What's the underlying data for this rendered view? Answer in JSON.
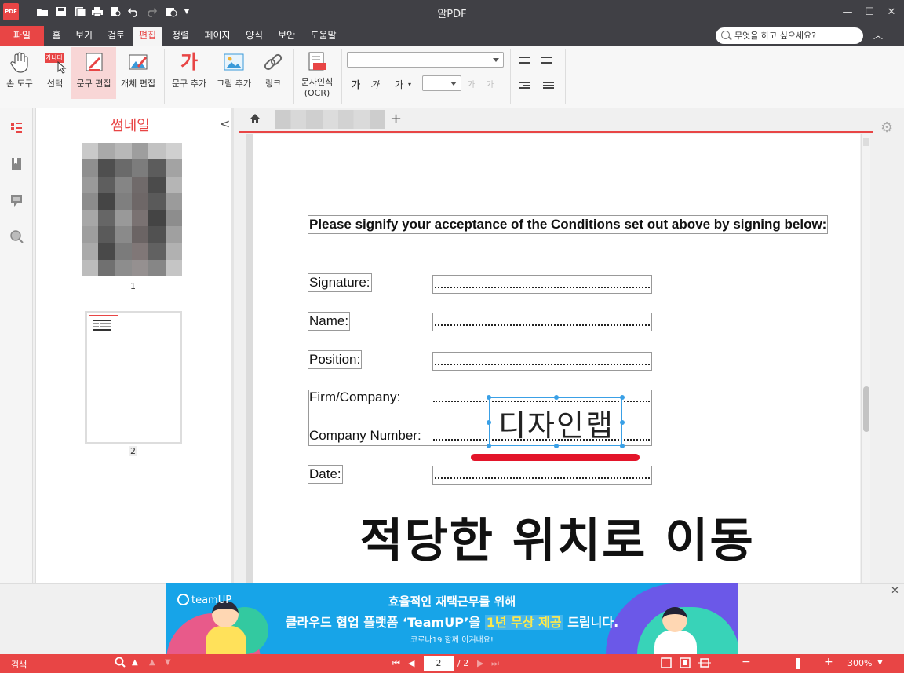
{
  "app": {
    "title": "알PDF",
    "logo_text": "PDF"
  },
  "menu": {
    "items": [
      "파일",
      "홈",
      "보기",
      "검토",
      "편집",
      "정렬",
      "페이지",
      "양식",
      "보안",
      "도움말"
    ],
    "active": "편집",
    "search_placeholder": "무엇을 하고 싶으세요?"
  },
  "ribbon": {
    "buttons": [
      {
        "label": "손 도구"
      },
      {
        "label": "선택",
        "badge": "가나다"
      },
      {
        "label": "문구 편집"
      },
      {
        "label": "개체 편집"
      },
      {
        "label": "문구 추가",
        "glyph": "가"
      },
      {
        "label": "그림 추가"
      },
      {
        "label": "링크"
      },
      {
        "label": "문자인식\n(OCR)"
      }
    ],
    "font_family_value": "",
    "font_size_value": "",
    "format_glyphs": {
      "bold": "가",
      "italic": "가",
      "color": "가",
      "grow": "가",
      "shrink": "가"
    }
  },
  "sidebar": {
    "title": "썸네일",
    "pages": [
      "1",
      "2"
    ],
    "icons": [
      "thumbnail-icon",
      "bookmark-icon",
      "comment-icon",
      "search-icon"
    ]
  },
  "tabs": {
    "add": "+"
  },
  "document": {
    "heading": "Please signify your acceptance of the Conditions set out above by signing below:",
    "fields": {
      "signature": "Signature:",
      "name": "Name:",
      "position": "Position:",
      "firm": "Firm/Company:",
      "company_number": "Company Number:",
      "date": "Date:"
    },
    "selected_text": "디자인랩",
    "caption": "적당한 위치로 이동"
  },
  "banner": {
    "brand": "teamUP",
    "line1": "효율적인 재택근무를 위해",
    "line2_prefix": "클라우드 협업 플랫폼 ‘TeamUP’을 ",
    "line2_highlight": "1년 무상 제공",
    "line2_suffix": " 드립니다.",
    "line3": "코로나19 함께 이겨내요!"
  },
  "status": {
    "search_label": "검색",
    "current_page": "2",
    "total_pages": "/ 2",
    "zoom": "300%"
  },
  "colors": {
    "accent": "#e84545",
    "titlebar": "#404045",
    "selection": "#3aa0e6"
  }
}
